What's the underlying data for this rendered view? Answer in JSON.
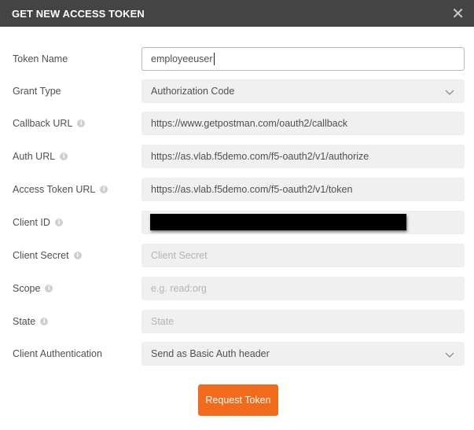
{
  "dialog": {
    "title": "GET NEW ACCESS TOKEN",
    "close_glyph": "✕",
    "info_glyph": "i",
    "fields": [
      {
        "label": "Token Name",
        "value": "employeeuser",
        "info": false
      },
      {
        "label": "Grant Type",
        "value": "Authorization Code",
        "info": false,
        "select": true
      },
      {
        "label": "Callback URL",
        "value": "https://www.getpostman.com/oauth2/callback",
        "info": true
      },
      {
        "label": "Auth URL",
        "value": "https://as.vlab.f5demo.com/f5-oauth2/v1/authorize",
        "info": true
      },
      {
        "label": "Access Token URL",
        "value": "https://as.vlab.f5demo.com/f5-oauth2/v1/token",
        "info": true
      },
      {
        "label": "Client ID",
        "value": "",
        "redacted": true,
        "info": true
      },
      {
        "label": "Client Secret",
        "placeholder": "Client Secret",
        "info": true
      },
      {
        "label": "Scope",
        "placeholder": "e.g. read:org",
        "info": true
      },
      {
        "label": "State",
        "placeholder": "State",
        "info": true
      },
      {
        "label": "Client Authentication",
        "value": "Send as Basic Auth header",
        "info": false,
        "select": true
      }
    ],
    "submit_label": "Request Token"
  },
  "colors": {
    "header_bg": "#444444",
    "accent_button": "#f26b1d",
    "field_bg": "#f0f0f0"
  },
  "icons": {
    "close": "close-icon",
    "info": "info-icon",
    "dropdown": "chevron-down-icon"
  }
}
